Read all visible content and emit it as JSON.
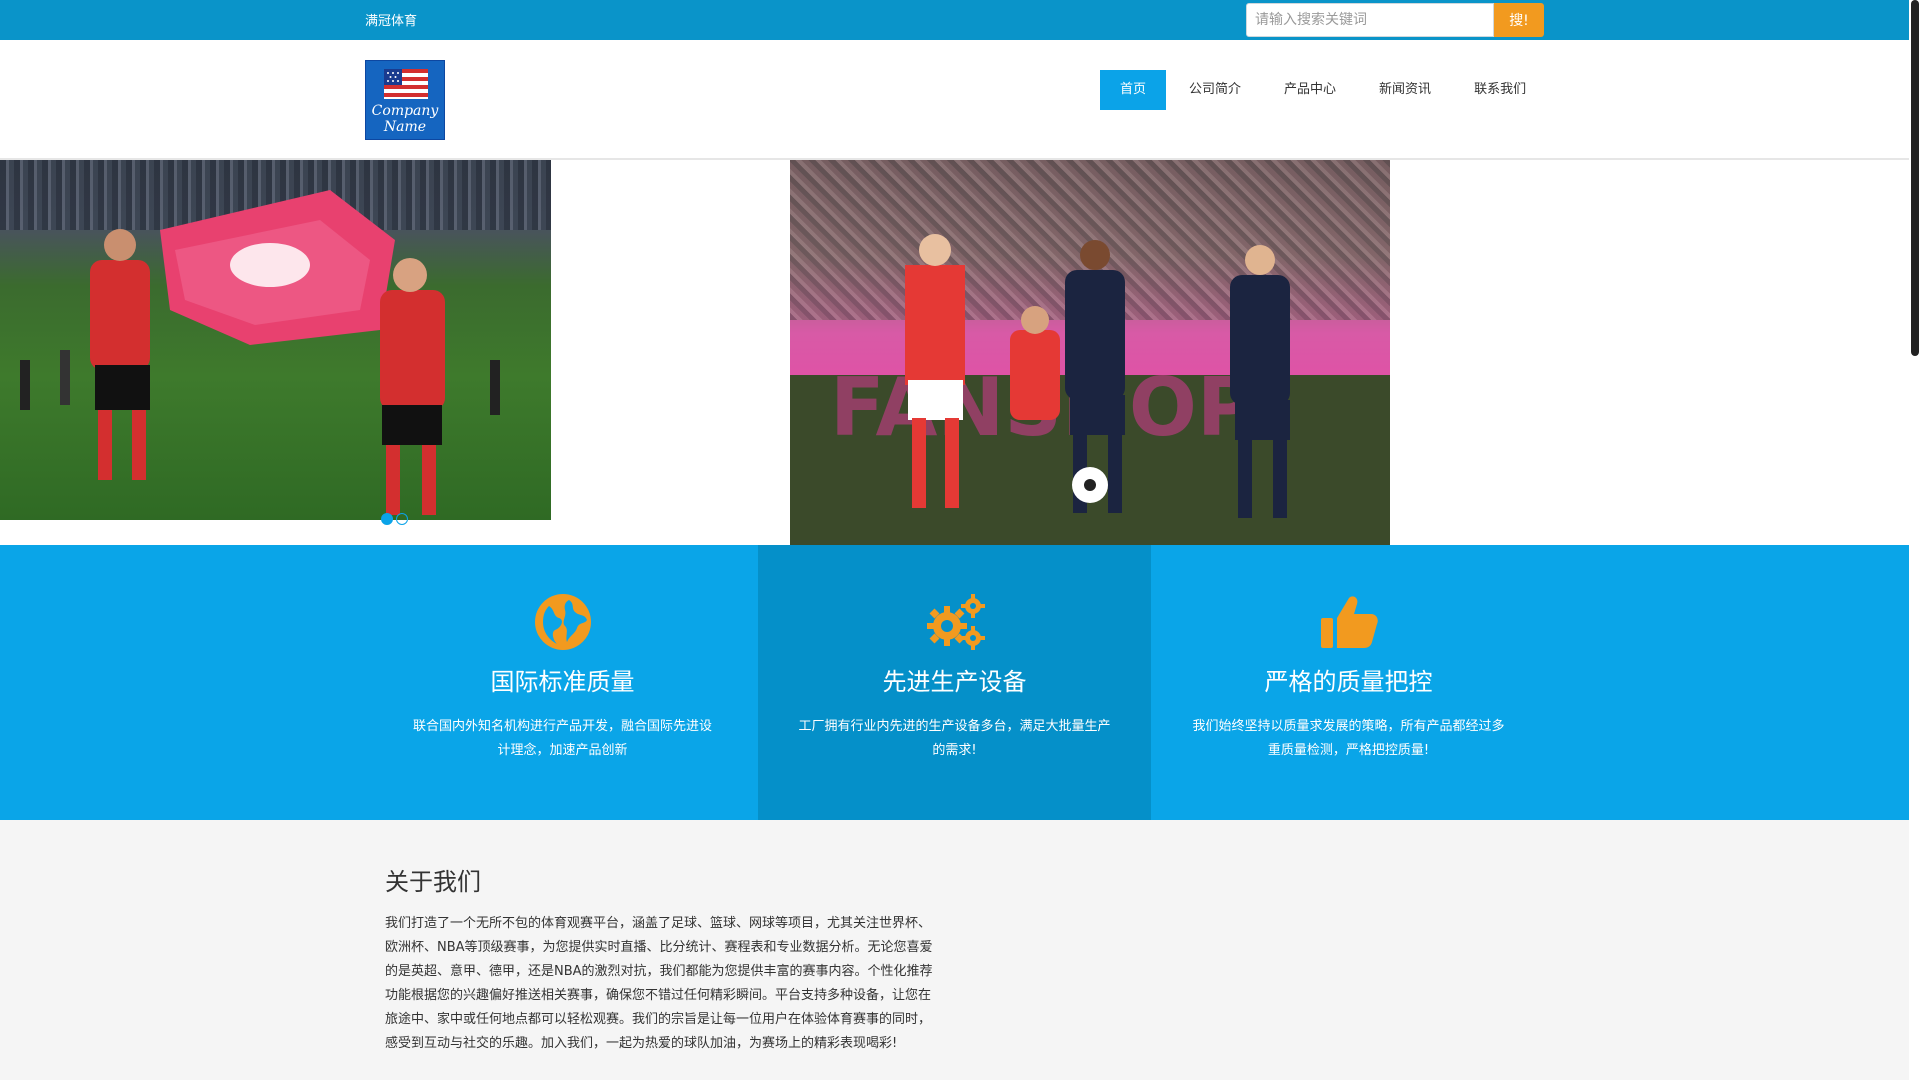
{
  "topbar": {
    "site_name": "满冠体育",
    "search_placeholder": "请输入搜索关键词",
    "search_button": "搜!"
  },
  "logo": {
    "line1": "Company",
    "line2": "Name"
  },
  "nav": {
    "items": [
      {
        "label": "首页",
        "active": true
      },
      {
        "label": "公司简介",
        "active": false
      },
      {
        "label": "产品中心",
        "active": false
      },
      {
        "label": "新闻资讯",
        "active": false
      },
      {
        "label": "联系我们",
        "active": false
      }
    ]
  },
  "banner": {
    "slides": 2,
    "active_slide": 1
  },
  "features": [
    {
      "icon": "globe-icon",
      "title": "国际标准质量",
      "desc": "联合国内外知名机构进行产品开发，融合国际先进设计理念，加速产品创新"
    },
    {
      "icon": "gears-icon",
      "title": "先进生产设备",
      "desc": "工厂拥有行业内先进的生产设备多台，满足大批量生产的需求!"
    },
    {
      "icon": "thumbs-up-icon",
      "title": "严格的质量把控",
      "desc": "我们始终坚持以质量求发展的策略，所有产品都经过多重质量检测，严格把控质量!"
    }
  ],
  "about": {
    "title": "关于我们",
    "text": "我们打造了一个无所不包的体育观赛平台，涵盖了足球、篮球、网球等项目，尤其关注世界杯、欧洲杯、NBA等顶级赛事，为您提供实时直播、比分统计、赛程表和专业数据分析。无论您喜爱的是英超、意甲、德甲，还是NBA的激烈对抗，我们都能为您提供丰富的赛事内容。个性化推荐功能根据您的兴趣偏好推送相关赛事，确保您不错过任何精彩瞬间。平台支持多种设备，让您在旅途中、家中或任何地点都可以轻松观赛。我们的宗旨是让每一位用户在体验体育赛事的同时，感受到互动与社交的乐趣。加入我们，一起为热爱的球队加油，为赛场上的精彩表现喝彩!"
  },
  "colors": {
    "topbar": "#0a94c9",
    "accent": "#0ba3e8",
    "features_bg": "#0aa5e8",
    "features_highlight": "#0590c9",
    "search_button": "#f29a1f",
    "icon_orange": "#f29a1f"
  }
}
